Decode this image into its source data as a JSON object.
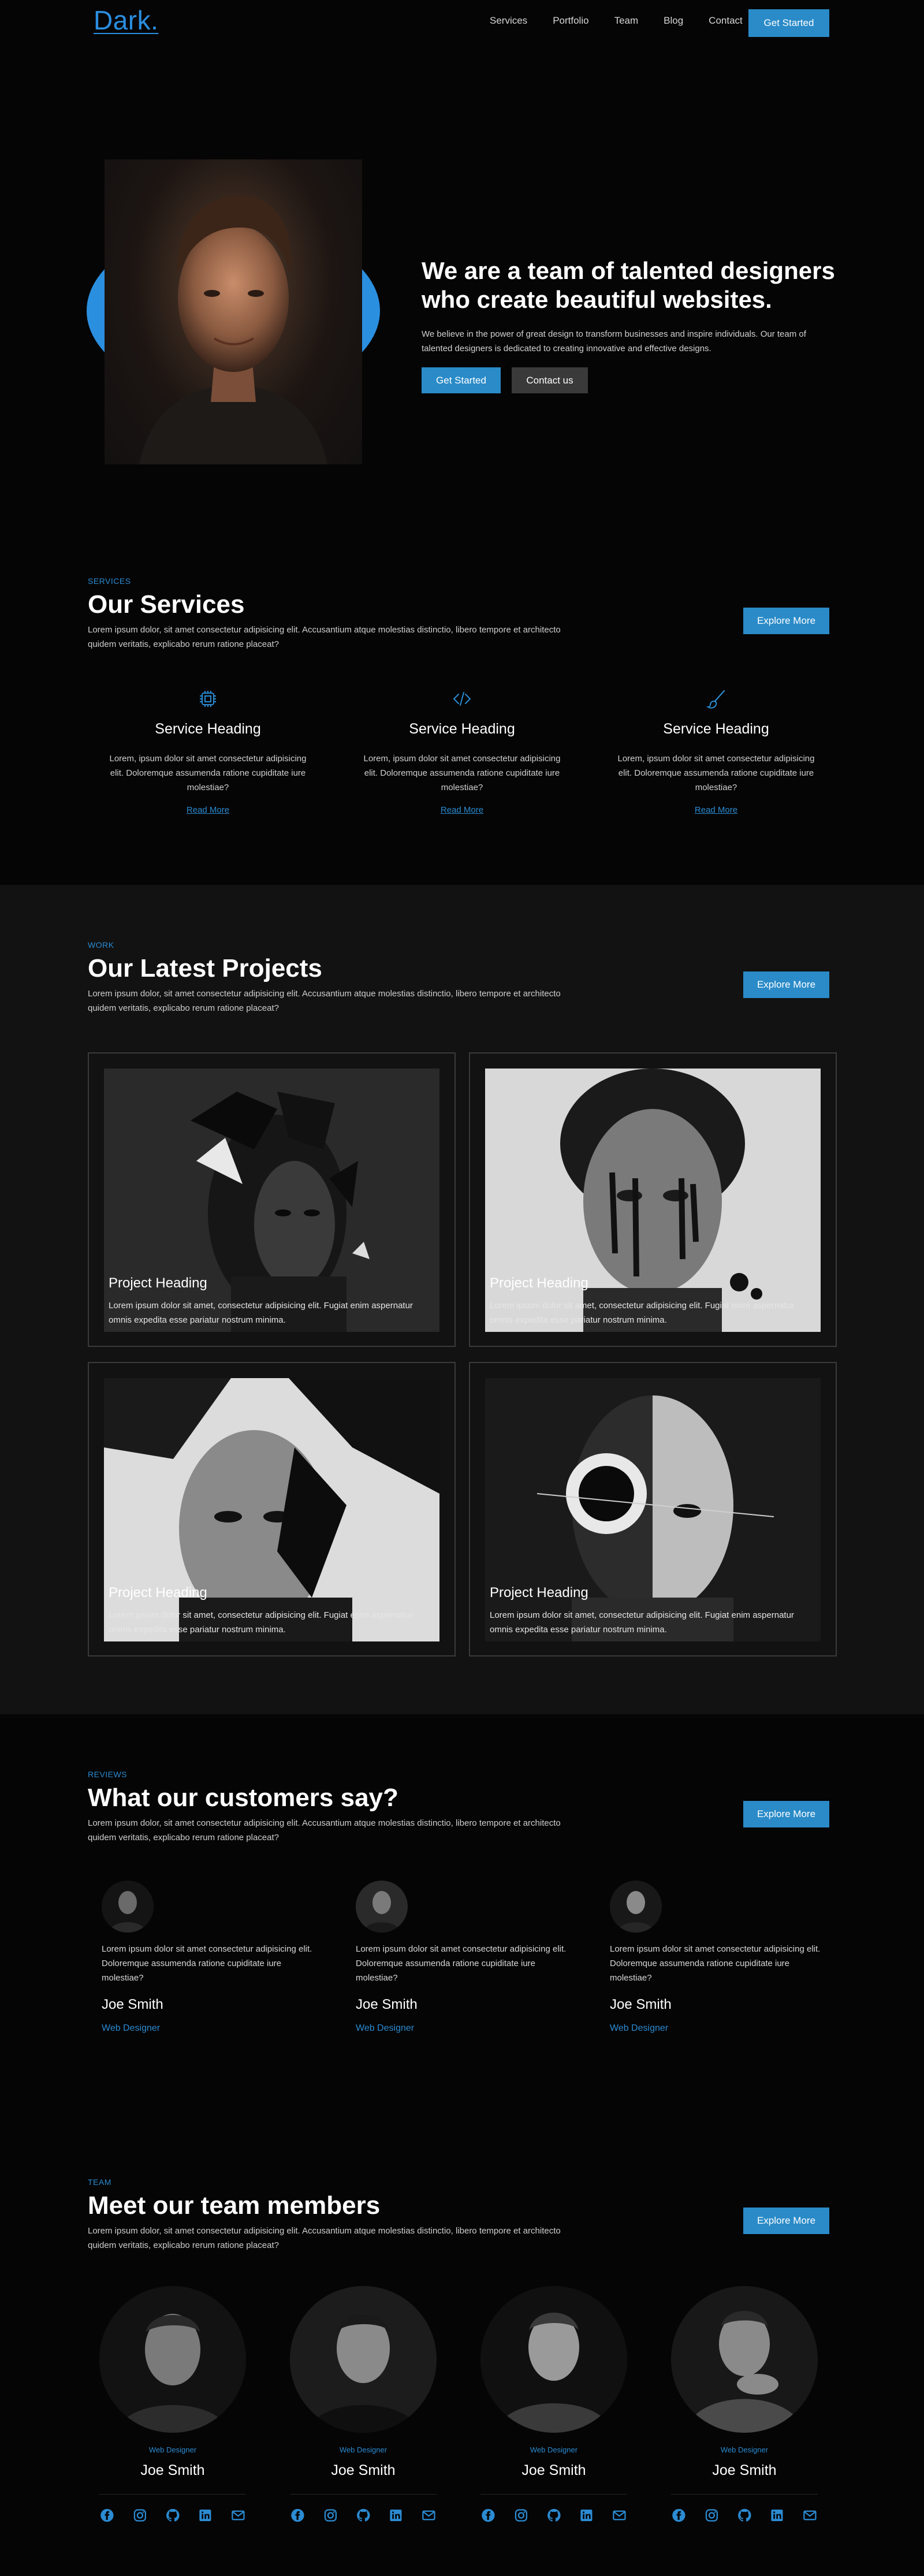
{
  "nav": {
    "logo": "Dark.",
    "links": [
      "Services",
      "Portfolio",
      "Team",
      "Blog",
      "Contact"
    ],
    "cta": "Get Started"
  },
  "hero": {
    "title": "We are a team of talented designers who create beautiful websites.",
    "text": "We believe in the power of great design to transform businesses and inspire individuals. Our team of talented designers is dedicated to creating innovative and effective designs.",
    "primary_btn": "Get Started",
    "secondary_btn": "Contact us"
  },
  "services": {
    "eyebrow": "SERVICES",
    "title": "Our Services",
    "subtitle": "Lorem ipsum dolor, sit amet consectetur adipisicing elit. Accusantium atque molestias distinctio, libero tempore et architecto quidem veritatis, explicabo rerum ratione placeat?",
    "explore": "Explore More",
    "items": [
      {
        "icon": "chip-icon",
        "heading": "Service Heading",
        "text": "Lorem, ipsum dolor sit amet consectetur adipisicing elit. Doloremque assumenda ratione cupiditate iure molestiae?",
        "link": "Read More"
      },
      {
        "icon": "code-icon",
        "heading": "Service Heading",
        "text": "Lorem, ipsum dolor sit amet consectetur adipisicing elit. Doloremque assumenda ratione cupiditate iure molestiae?",
        "link": "Read More"
      },
      {
        "icon": "brush-icon",
        "heading": "Service Heading",
        "text": "Lorem, ipsum dolor sit amet consectetur adipisicing elit. Doloremque assumenda ratione cupiditate iure molestiae?",
        "link": "Read More"
      }
    ]
  },
  "projects": {
    "eyebrow": "WORK",
    "title": "Our Latest Projects",
    "subtitle": "Lorem ipsum dolor, sit amet consectetur adipisicing elit. Accusantium atque molestias distinctio, libero tempore et architecto quidem veritatis, explicabo rerum ratione placeat?",
    "explore": "Explore More",
    "items": [
      {
        "heading": "Project Heading",
        "text": "Lorem ipsum dolor sit amet, consectetur adipisicing elit. Fugiat enim aspernatur omnis expedita esse pariatur nostrum minima."
      },
      {
        "heading": "Project Heading",
        "text": "Lorem ipsum dolor sit amet, consectetur adipisicing elit. Fugiat enim aspernatur omnis expedita esse pariatur nostrum minima."
      },
      {
        "heading": "Project Heading",
        "text": "Lorem ipsum dolor sit amet, consectetur adipisicing elit. Fugiat enim aspernatur omnis expedita esse pariatur nostrum minima."
      },
      {
        "heading": "Project Heading",
        "text": "Lorem ipsum dolor sit amet, consectetur adipisicing elit. Fugiat enim aspernatur omnis expedita esse pariatur nostrum minima."
      }
    ]
  },
  "reviews": {
    "eyebrow": "REVIEWS",
    "title": "What our customers say?",
    "subtitle": "Lorem ipsum dolor, sit amet consectetur adipisicing elit. Accusantium atque molestias distinctio, libero tempore et architecto quidem veritatis, explicabo rerum ratione placeat?",
    "explore": "Explore More",
    "items": [
      {
        "text": "Lorem ipsum dolor sit amet consectetur adipisicing elit. Doloremque assumenda ratione cupiditate iure molestiae?",
        "name": "Joe Smith",
        "role": "Web Designer"
      },
      {
        "text": "Lorem ipsum dolor sit amet consectetur adipisicing elit. Doloremque assumenda ratione cupiditate iure molestiae?",
        "name": "Joe Smith",
        "role": "Web Designer"
      },
      {
        "text": "Lorem ipsum dolor sit amet consectetur adipisicing elit. Doloremque assumenda ratione cupiditate iure molestiae?",
        "name": "Joe Smith",
        "role": "Web Designer"
      }
    ]
  },
  "team": {
    "eyebrow": "TEAM",
    "title": "Meet our team members",
    "subtitle": "Lorem ipsum dolor, sit amet consectetur adipisicing elit. Accusantium atque molestias distinctio, libero tempore et architecto quidem veritatis, explicabo rerum ratione placeat?",
    "explore": "Explore More",
    "members": [
      {
        "role": "Web Designer",
        "name": "Joe Smith"
      },
      {
        "role": "Web Designer",
        "name": "Joe Smith"
      },
      {
        "role": "Web Designer",
        "name": "Joe Smith"
      },
      {
        "role": "Web Designer",
        "name": "Joe Smith"
      }
    ],
    "social_icons": [
      "facebook-icon",
      "instagram-icon",
      "github-icon",
      "linkedin-icon",
      "mail-icon"
    ]
  },
  "colors": {
    "accent": "#2a8bc8",
    "accent_text": "#2b8bd2",
    "background": "#050505",
    "band": "#121212"
  }
}
